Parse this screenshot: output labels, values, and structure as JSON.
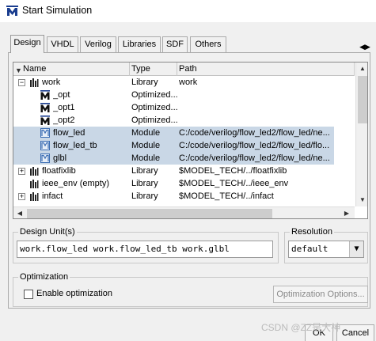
{
  "window": {
    "title": "Start Simulation",
    "app_icon": "modelsim-logo-icon"
  },
  "tabs": [
    {
      "label": "Design",
      "active": true
    },
    {
      "label": "VHDL",
      "active": false
    },
    {
      "label": "Verilog",
      "active": false
    },
    {
      "label": "Libraries",
      "active": false
    },
    {
      "label": "SDF",
      "active": false
    },
    {
      "label": "Others",
      "active": false
    }
  ],
  "tree": {
    "columns": [
      "Name",
      "Type",
      "Path"
    ],
    "rows": [
      {
        "name": "work",
        "type": "Library",
        "path": "work",
        "icon": "library-icon",
        "expander": "−",
        "selected": false
      },
      {
        "name": "_opt",
        "type": "Optimized...",
        "path": "",
        "icon": "optimized-design-icon",
        "expander": "",
        "selected": false
      },
      {
        "name": "_opt1",
        "type": "Optimized...",
        "path": "",
        "icon": "optimized-design-icon",
        "expander": "",
        "selected": false
      },
      {
        "name": "_opt2",
        "type": "Optimized...",
        "path": "",
        "icon": "optimized-design-icon",
        "expander": "",
        "selected": false
      },
      {
        "name": "flow_led",
        "type": "Module",
        "path": "C:/code/verilog/flow_led2/flow_led/ne...",
        "icon": "module-icon",
        "expander": "",
        "selected": true
      },
      {
        "name": "flow_led_tb",
        "type": "Module",
        "path": "C:/code/verilog/flow_led2/flow_led/flo...",
        "icon": "module-icon",
        "expander": "",
        "selected": true
      },
      {
        "name": "glbl",
        "type": "Module",
        "path": "C:/code/verilog/flow_led2/flow_led/ne...",
        "icon": "module-icon",
        "expander": "",
        "selected": true
      },
      {
        "name": "floatfixlib",
        "type": "Library",
        "path": "$MODEL_TECH/../floatfixlib",
        "icon": "library-icon",
        "expander": "+",
        "selected": false
      },
      {
        "name": "ieee_env  (empty)",
        "type": "Library",
        "path": "$MODEL_TECH/../ieee_env",
        "icon": "library-icon",
        "expander": "",
        "selected": false
      },
      {
        "name": "infact",
        "type": "Library",
        "path": "$MODEL_TECH/../infact",
        "icon": "library-icon",
        "expander": "+",
        "selected": false
      }
    ]
  },
  "design_unit": {
    "label": "Design Unit(s)",
    "value": "work.flow_led work.flow_led_tb work.glbl"
  },
  "resolution": {
    "label": "Resolution",
    "value": "default"
  },
  "optimization": {
    "label": "Optimization",
    "checkbox_label": "Enable optimization",
    "checked": false,
    "options_button": "Optimization Options..."
  },
  "buttons": {
    "ok": "OK",
    "cancel": "Cancel"
  },
  "watermark": "CSDN @ZZ是大神"
}
